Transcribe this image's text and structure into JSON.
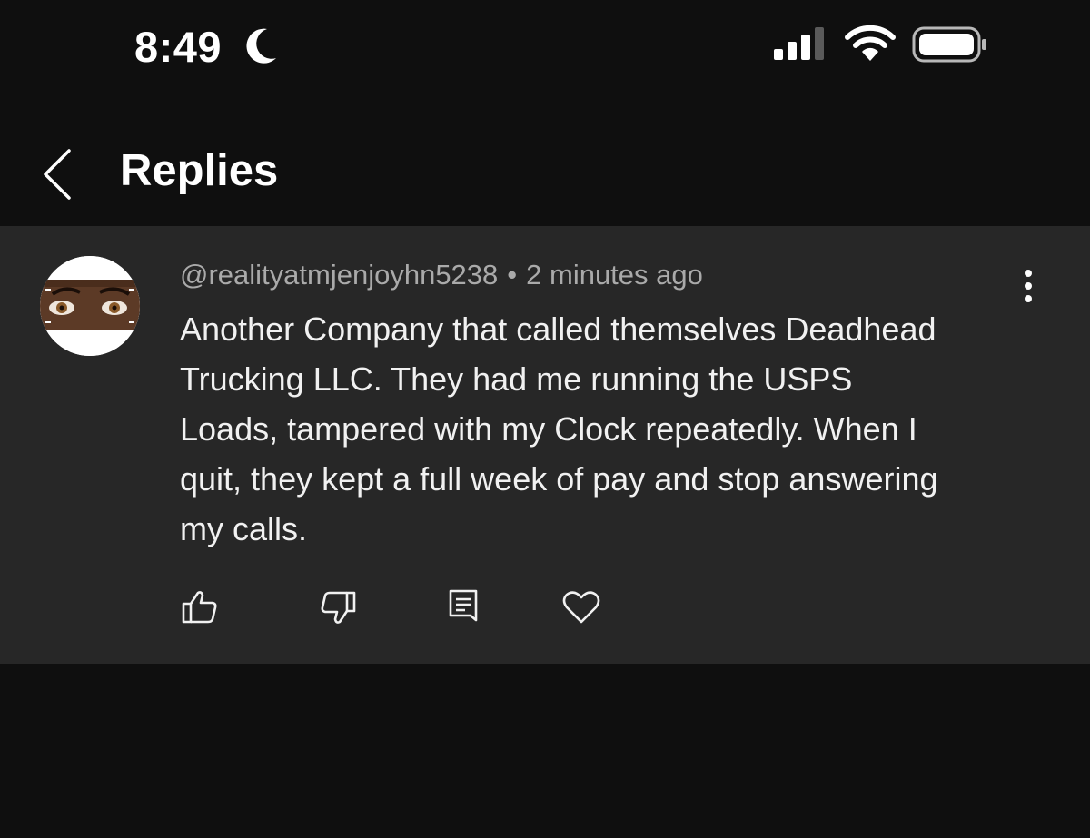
{
  "status_bar": {
    "time": "8:49",
    "icons": [
      "moon-icon",
      "signal-icon",
      "wifi-icon",
      "battery-icon"
    ]
  },
  "header": {
    "title": "Replies",
    "back_icon": "chevron-left-icon"
  },
  "comment": {
    "author": "@realityatmjenjoyhn5238",
    "separator": "•",
    "timestamp": "2 minutes ago",
    "text": "Another Company that called themselves Deadhead\nTrucking LLC. They had me running the USPS\nLoads, tampered with my Clock repeatedly.  When I\nquit, they kept a full week of pay and stop answering\nmy calls.",
    "actions": [
      "thumbs-up-icon",
      "thumbs-down-icon",
      "reply-icon",
      "heart-icon"
    ],
    "menu_icon": "more-vertical-icon"
  },
  "colors": {
    "background": "#0f0f0f",
    "card": "#272727",
    "text_primary": "#f1f1f1",
    "text_secondary": "#aaaaaa"
  }
}
